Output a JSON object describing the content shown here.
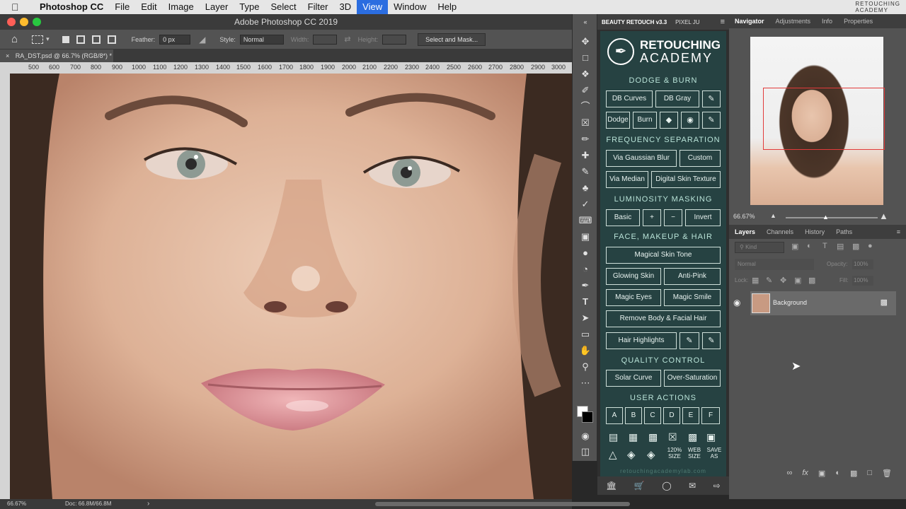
{
  "menubar": {
    "app": "Photoshop CC",
    "items": [
      "File",
      "Edit",
      "Image",
      "Layer",
      "Type",
      "Select",
      "Filter",
      "3D",
      "View",
      "Window",
      "Help"
    ],
    "active": "View",
    "logo_line1": "RETOUCHING",
    "logo_line2": "ACADEMY"
  },
  "titlebar": {
    "title": "Adobe Photoshop CC 2019"
  },
  "options": {
    "feather_label": "Feather:",
    "feather_value": "0 px",
    "style_label": "Style:",
    "style_value": "Normal",
    "width_label": "Width:",
    "height_label": "Height:",
    "select_mask": "Select and Mask..."
  },
  "document": {
    "tab": "RA_DST.psd @ 66.7% (RGB/8*) *"
  },
  "ruler": [
    "500",
    "600",
    "700",
    "800",
    "900",
    "1000",
    "1100",
    "1200",
    "1300",
    "1400",
    "1500",
    "1600",
    "1700",
    "1800",
    "1900",
    "2000",
    "2100",
    "2200",
    "2300",
    "2400",
    "2500",
    "2600",
    "2700",
    "2800",
    "2900",
    "3000"
  ],
  "status": {
    "zoom": "66.67%",
    "doc": "Doc: 66.8M/66.8M",
    "arrow": "›"
  },
  "retouch": {
    "tab1": "BEAUTY RETOUCH v3.3",
    "tab2": "PIXEL JU",
    "logo_top": "RETOUCHING",
    "logo_bottom": "ACADEMY",
    "sections": {
      "dodge": "DODGE & BURN",
      "freq": "FREQUENCY SEPARATION",
      "lum": "LUMINOSITY MASKING",
      "face": "FACE, MAKEUP & HAIR",
      "qc": "QUALITY CONTROL",
      "ua": "USER ACTIONS"
    },
    "buttons": {
      "db_curves": "DB Curves",
      "db_gray": "DB Gray",
      "dodge": "Dodge",
      "burn": "Burn",
      "via_gaussian": "Via Gaussian Blur",
      "custom": "Custom",
      "via_median": "Via Median",
      "digital_skin": "Digital Skin Texture",
      "basic": "Basic",
      "plus": "+",
      "minus": "−",
      "invert": "Invert",
      "magical_skin": "Magical Skin Tone",
      "glowing": "Glowing Skin",
      "anti_pink": "Anti-Pink",
      "magic_eyes": "Magic Eyes",
      "magic_smile": "Magic Smile",
      "remove_hair": "Remove Body & Facial Hair",
      "hair_highlights": "Hair Highlights",
      "solar": "Solar Curve",
      "oversat": "Over-Saturation",
      "a": "A",
      "b": "B",
      "c": "C",
      "d": "D",
      "e": "E",
      "f": "F",
      "size_120": "120%\nSIZE",
      "web_size": "WEB\nSIZE",
      "save_as": "SAVE\nAS"
    },
    "url": "retouchingacademylab.com"
  },
  "navigator": {
    "tabs": [
      "Navigator",
      "Adjustments",
      "Info",
      "Properties"
    ],
    "zoom": "66.67%"
  },
  "layers": {
    "tabs": [
      "Layers",
      "Channels",
      "History",
      "Paths"
    ],
    "kind": "Kind",
    "blend": "Normal",
    "opacity_label": "Opacity:",
    "opacity": "100%",
    "lock_label": "Lock:",
    "fill_label": "Fill:",
    "fill": "100%",
    "layer_name": "Background"
  },
  "colors": {
    "active_menu": "#2b6de0",
    "panel_teal": "#264242",
    "accent_text": "#b9e3d8"
  }
}
